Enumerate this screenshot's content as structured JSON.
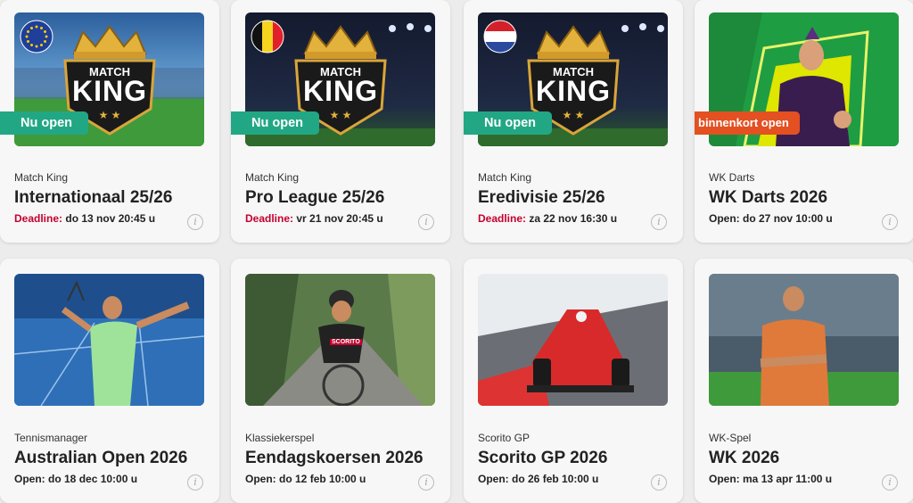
{
  "cards": [
    {
      "category": "Match King",
      "title": "Internationaal 25/26",
      "badge": "Nu open",
      "meta_label": "Deadline:",
      "meta_value": "do 13 nov 20:45 u",
      "flag": "eu-flag-icon",
      "logo_top": "MATCH",
      "logo_bottom": "KING"
    },
    {
      "category": "Match King",
      "title": "Pro League 25/26",
      "badge": "Nu open",
      "meta_label": "Deadline:",
      "meta_value": "vr 21 nov 20:45 u",
      "flag": "belgium-flag-icon",
      "logo_top": "MATCH",
      "logo_bottom": "KING"
    },
    {
      "category": "Match King",
      "title": "Eredivisie 25/26",
      "badge": "Nu open",
      "meta_label": "Deadline:",
      "meta_value": "za 22 nov 16:30 u",
      "flag": "netherlands-flag-icon",
      "logo_top": "MATCH",
      "logo_bottom": "KING"
    },
    {
      "category": "WK Darts",
      "title": "WK Darts 2026",
      "badge": "binnenkort open",
      "meta_label": "Open:",
      "meta_value": "do 27 nov 10:00 u"
    },
    {
      "category": "Tennismanager",
      "title": "Australian Open 2026",
      "meta_label": "Open:",
      "meta_value": "do 18 dec 10:00 u"
    },
    {
      "category": "Klassiekerspel",
      "title": "Eendagskoersen 2026",
      "meta_label": "Open:",
      "meta_value": "do 12 feb 10:00 u",
      "jersey_text": "SCORITO"
    },
    {
      "category": "Scorito GP",
      "title": "Scorito GP 2026",
      "meta_label": "Open:",
      "meta_value": "do 26 feb 10:00 u"
    },
    {
      "category": "WK-Spel",
      "title": "WK 2026",
      "meta_label": "Open:",
      "meta_value": "ma 13 apr 11:00 u"
    }
  ],
  "info_icon": "info-icon",
  "colors": {
    "open_badge": "#22a785",
    "soon_badge": "#e35022",
    "deadline": "#c4002f"
  }
}
